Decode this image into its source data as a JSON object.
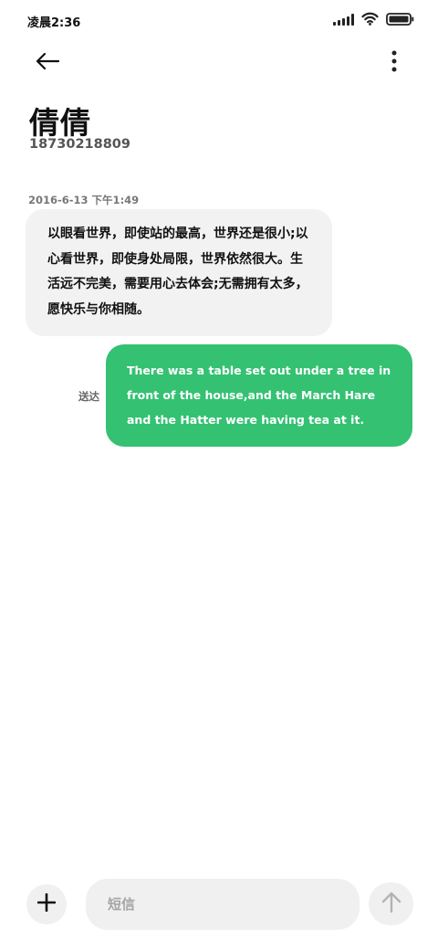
{
  "status_bar": {
    "time": "凌晨2:36",
    "icons": [
      "signal-icon",
      "wifi-icon",
      "battery-icon"
    ]
  },
  "header": {
    "back_icon": "back-arrow-icon",
    "more_icon": "more-vertical-icon",
    "contact_name": "倩倩",
    "contact_phone": "18730218809"
  },
  "conversation": {
    "timestamp": "2016-6-13 下午1:49",
    "incoming_message": "以眼看世界，即使站的最高，世界还是很小;以心看世界，即使身处局限，世界依然很大。生活远不完美，需要用心去体会;无需拥有太多，愿快乐与你相随。",
    "outgoing_message": "There was a table set out under a tree in front of the house,and the March Hare and the Hatter were having tea at it.",
    "outgoing_status": "送达"
  },
  "composer": {
    "add_icon": "plus-icon",
    "placeholder": "短信",
    "value": "",
    "send_icon": "send-arrow-up-icon"
  },
  "colors": {
    "accent_green": "#34c172",
    "bubble_gray": "#f2f2f2",
    "input_gray": "#f0f0f0"
  }
}
